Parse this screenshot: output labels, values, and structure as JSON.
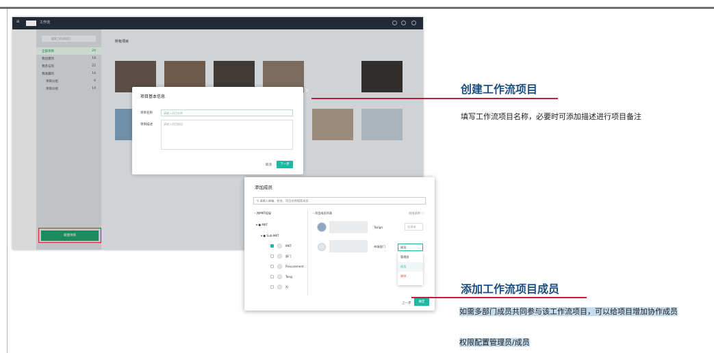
{
  "screenshot": {
    "nav_tab_workspace": "工作流",
    "sidebar": {
      "search_placeholder": "搜索工作流项目",
      "items": [
        {
          "label": "全部项目",
          "count": "24"
        },
        {
          "label": "我创建的",
          "count": "18"
        },
        {
          "label": "我参与的",
          "count": "22"
        },
        {
          "label": "我收藏的",
          "count": "14"
        },
        {
          "label": "项目分组",
          "count": "6"
        },
        {
          "label": "项目分组",
          "count": "14"
        }
      ],
      "new_button": "新建项目"
    },
    "main_title": "所有项目"
  },
  "modal_basic": {
    "title": "项目基本信息",
    "name_label": "项目名称",
    "name_placeholder": "请输入项目名称",
    "desc_label": "项目描述",
    "desc_placeholder": "请输入项目描述",
    "cancel": "取消",
    "next": "下一步"
  },
  "modal_members": {
    "title": "添加成员",
    "search_placeholder": "请输入邮箱、姓名、项目名称搜索成员",
    "back_label": "按MKT组架",
    "right_header": "项目成员列表",
    "permission_label": "权限说明",
    "tree": [
      "MKT",
      "Sub-MKT",
      "MKT",
      "部门",
      "Procurement",
      "Tang",
      "Xi"
    ],
    "member1_dept": "Tezign",
    "member1_role": "创建者",
    "member2_dept": "市场部门",
    "member2_role": "成员",
    "role_options": [
      "管理员",
      "成员",
      "移除"
    ],
    "prev": "上一步",
    "done": "确定"
  },
  "annotations": {
    "create_title": "创建工作流项目",
    "create_desc": "填写工作流项目名称，必要时可添加描述进行项目备注",
    "add_title": "添加工作流项目成员",
    "add_desc": "如需多部门成员共同参与该工作流项目，可以给项目增加协作成员",
    "roles_desc": "权限配置管理员/成员"
  },
  "colors": {
    "accent_teal": "#20b8a4",
    "heading_blue": "#1c4e80",
    "line_red": "#c41d3a",
    "highlight_blue": "#c5dcee"
  }
}
